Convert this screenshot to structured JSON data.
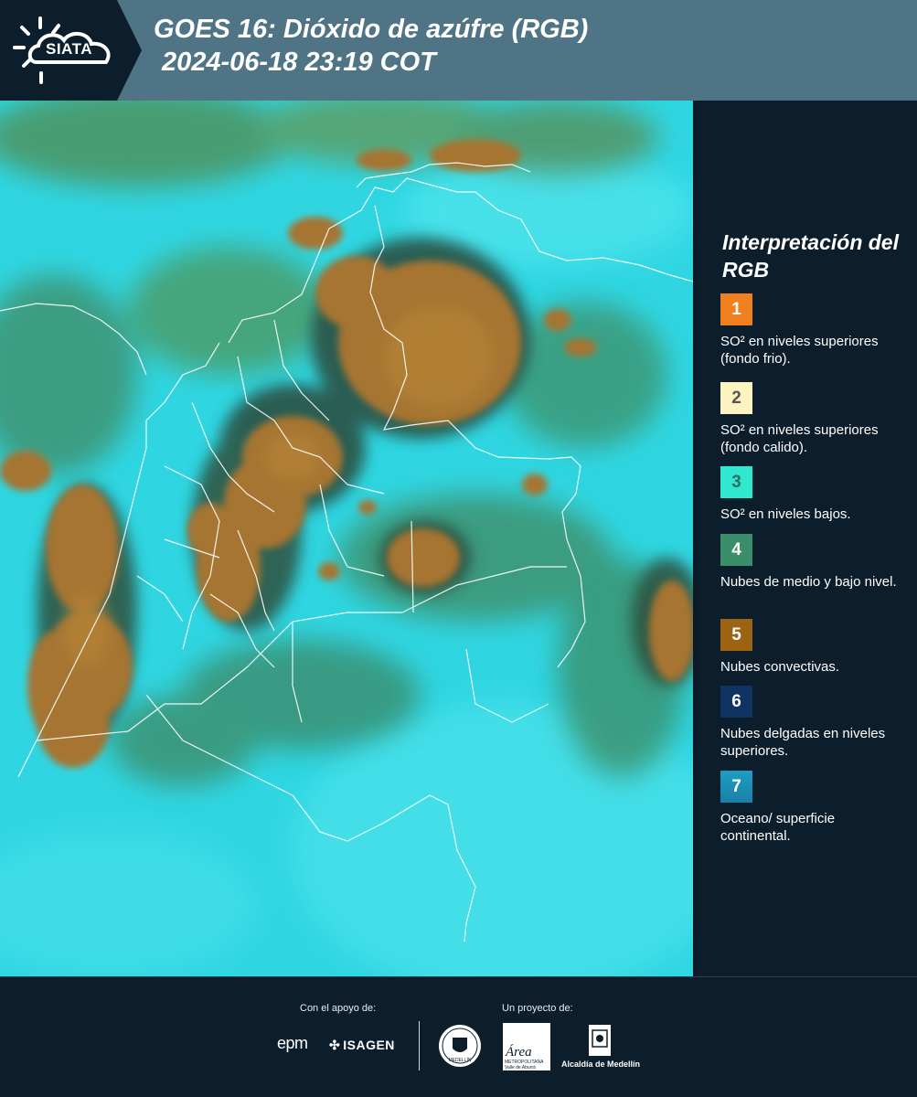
{
  "header": {
    "logo": "SIATA",
    "title_line1": "GOES 16: Dióxido de azúfre (RGB)",
    "title_line2": "2024-06-18 23:19 COT"
  },
  "legend": {
    "title": "Interpretación del RGB",
    "items": [
      {
        "number": "1",
        "color": "#f07f1e",
        "number_color": "#ffffff",
        "label": "SO² en niveles superiores (fondo frio)."
      },
      {
        "number": "2",
        "color": "#fbf4c0",
        "number_color": "#555555",
        "label": "SO² en niveles superiores (fondo calido)."
      },
      {
        "number": "3",
        "color": "#2fe8cf",
        "number_color": "#2a6e66",
        "label": "SO² en niveles bajos."
      },
      {
        "number": "4",
        "color": "#3a8f6a",
        "number_color": "#ffffff",
        "label": "Nubes de medio y bajo nivel."
      },
      {
        "number": "5",
        "color": "#9c6412",
        "number_color": "#ffffff",
        "label": "Nubes convectivas."
      },
      {
        "number": "6",
        "color": "#0f3462",
        "number_color": "#ffffff",
        "label": "Nubes delgadas en niveles superiores."
      },
      {
        "number": "7",
        "color": "#1e9ec4",
        "number_color": "#ffffff",
        "label": "Oceano/ superficie continental."
      }
    ]
  },
  "footer": {
    "support_label": "Con el apoyo de:",
    "support_logos": [
      "epm",
      "ISAGEN"
    ],
    "project_label": "Un proyecto de:",
    "area_logo": "Área",
    "area_sub": "METROPOLITANA Valle de Aburrá",
    "alcaldia": "Alcaldía de Medellín",
    "seal": "MEDELLÍN"
  },
  "colors": {
    "header_bg": "#4f7486",
    "panel_bg": "#0c1e2c",
    "map_background": "#2fd6e2",
    "convective_cloud": "#9c6d2a"
  }
}
